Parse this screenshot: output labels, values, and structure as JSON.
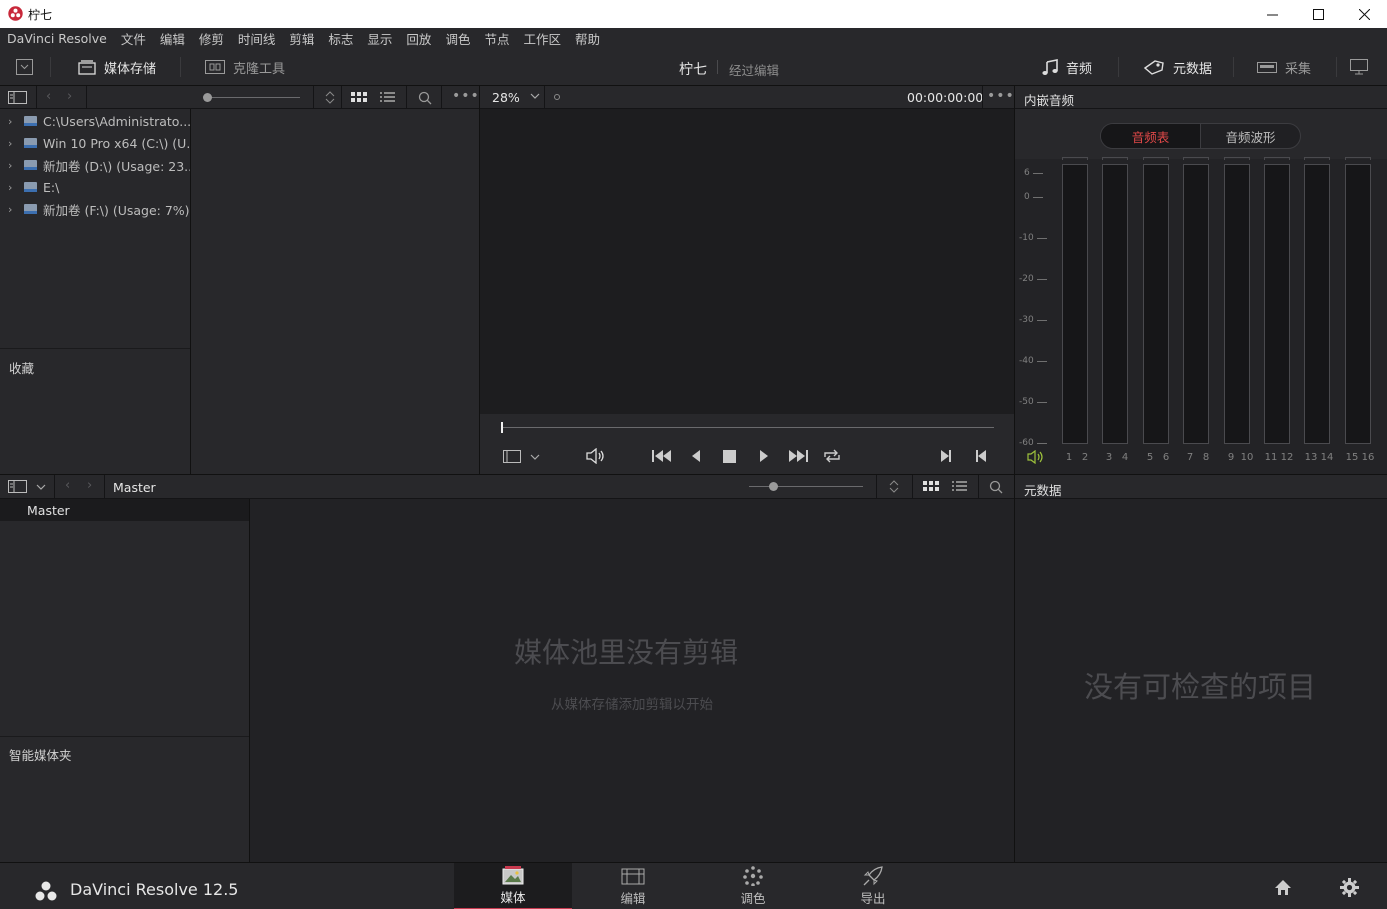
{
  "window": {
    "title": "柠七"
  },
  "menu": [
    "DaVinci Resolve",
    "文件",
    "编辑",
    "修剪",
    "时间线",
    "剪辑",
    "标志",
    "显示",
    "回放",
    "调色",
    "节点",
    "工作区",
    "帮助"
  ],
  "toolbar": {
    "media_storage": "媒体存储",
    "clone_tool": "克隆工具",
    "project_name": "柠七",
    "project_state": "经过编辑",
    "audio": "音频",
    "metadata": "元数据",
    "capture": "采集"
  },
  "storage": {
    "drives": [
      "C:\\Users\\Administrato...",
      "Win 10 Pro x64 (C:\\) (U...",
      "新加卷 (D:\\) (Usage: 23...",
      "E:\\",
      "新加卷 (F:\\) (Usage: 7%)"
    ],
    "favorites_label": "收藏"
  },
  "viewer": {
    "zoom": "28%",
    "timecode": "00:00:00:00"
  },
  "audio_panel": {
    "title": "内嵌音频",
    "tab_meters": "音频表",
    "tab_waveform": "音频波形",
    "scale": [
      "6",
      "0",
      "-10",
      "-20",
      "-30",
      "-40",
      "-50",
      "-60"
    ],
    "channels": [
      "1",
      "2",
      "3",
      "4",
      "5",
      "6",
      "7",
      "8",
      "9",
      "10",
      "11",
      "12",
      "13",
      "14",
      "15",
      "16"
    ],
    "active_tab_color": "#e04848"
  },
  "media_pool": {
    "bin_header": "Master",
    "master_item": "Master",
    "smart_bins_label": "智能媒体夹",
    "empty_title": "媒体池里没有剪辑",
    "empty_subtitle": "从媒体存储添加剪辑以开始"
  },
  "metadata_panel": {
    "title": "元数据",
    "empty": "没有可检查的项目"
  },
  "footer": {
    "app_name": "DaVinci Resolve 12.5",
    "pages": [
      "媒体",
      "编辑",
      "调色",
      "导出"
    ],
    "accent": "#c83a4f"
  }
}
